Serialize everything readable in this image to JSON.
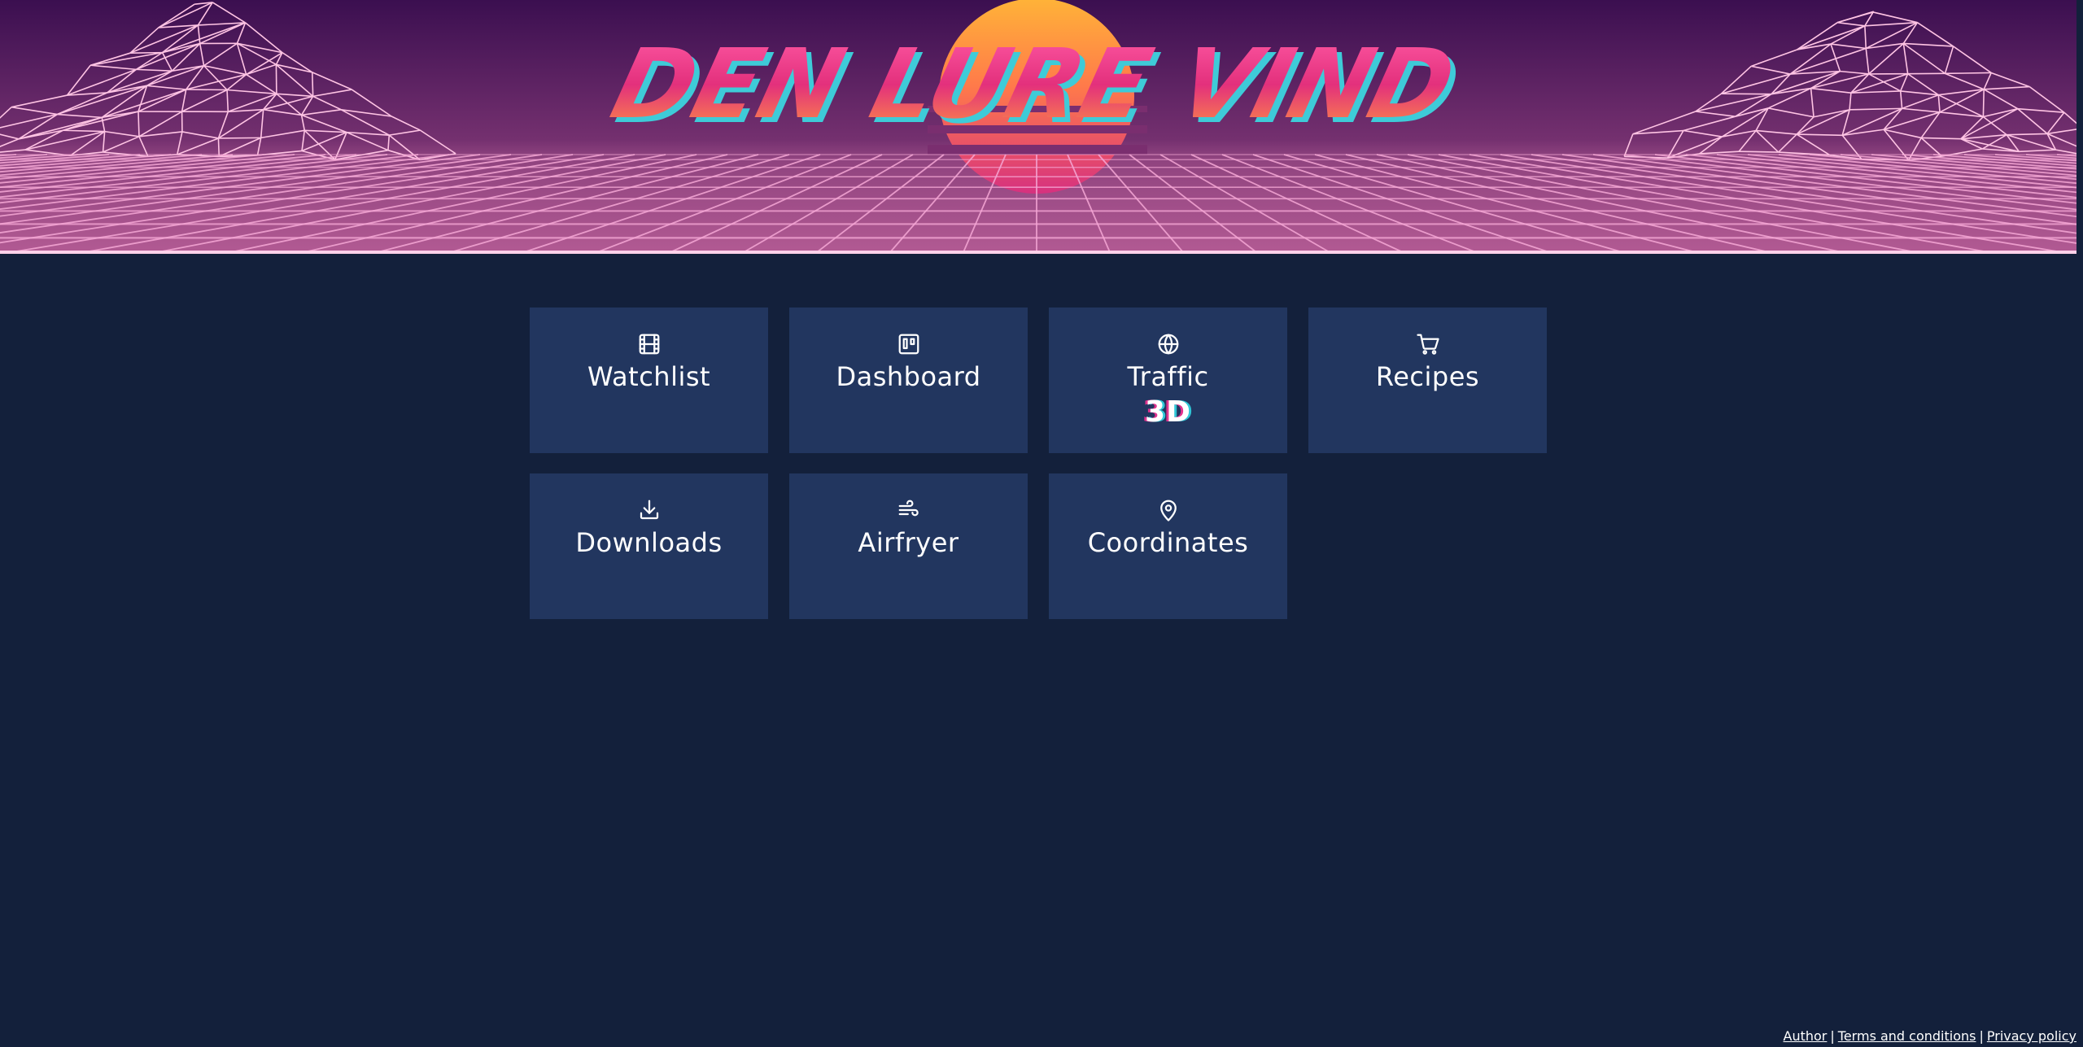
{
  "banner": {
    "logo_text": "DEN LURE VIND"
  },
  "tiles": [
    {
      "label": "Watchlist",
      "icon": "film-icon"
    },
    {
      "label": "Dashboard",
      "icon": "kanban-board-icon"
    },
    {
      "label": "Traffic",
      "icon": "globe-icon",
      "badge": "3D"
    },
    {
      "label": "Recipes",
      "icon": "shopping-cart-icon"
    },
    {
      "label": "Downloads",
      "icon": "download-icon"
    },
    {
      "label": "Airfryer",
      "icon": "wind-icon"
    },
    {
      "label": "Coordinates",
      "icon": "map-pin-icon"
    }
  ],
  "footer": {
    "links": [
      "Author",
      "Terms and conditions",
      "Privacy policy"
    ],
    "separator": "|"
  },
  "colors": {
    "background": "#13203b",
    "tile": "#22365f",
    "sky_top": "#3d0f52",
    "grid_line": "#f6a8d6",
    "sun_top": "#ffb23a",
    "sun_bottom": "#e03a8a",
    "logo_pink": "#e9307d",
    "logo_cyan": "#3ecbd8"
  }
}
